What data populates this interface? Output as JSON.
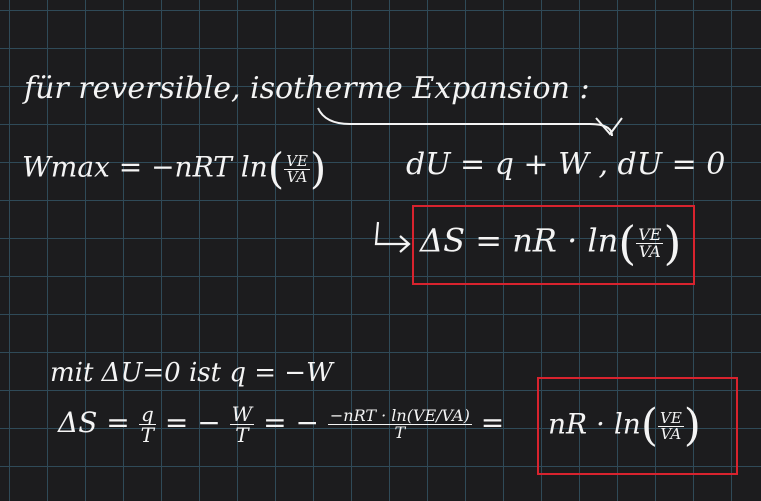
{
  "note": {
    "line1": "für reversible, isotherme Expansion :",
    "wmax_lhs": "Wmax = −nRT ln",
    "wmax_num": "VE",
    "wmax_den": "VA",
    "du_eq": "dU = q + W ,  dU = 0",
    "ds_lhs": "ΔS = nR · ln",
    "ds_num": "VE",
    "ds_den": "VA",
    "mit_line": "mit  ΔU=0  ist  q = −W",
    "ds2_lhs": "ΔS =",
    "ds2_f1_num": "q",
    "ds2_f1_den": "T",
    "ds2_mid": "= −",
    "ds2_f2_num": "W",
    "ds2_f2_den": "T",
    "ds2_eq3": "= −",
    "ds2_f3_num": "−nRT · ln(VE/VA)",
    "ds2_f3_den": "T",
    "ds2_eq4": "=",
    "ds2_result": "nR · ln",
    "ds2_res_num": "VE",
    "ds2_res_den": "VA"
  },
  "colors": {
    "background": "#1c1c1e",
    "grid": "#2f4a58",
    "ink": "#f4f4f4",
    "highlight_box": "#d8232e"
  }
}
